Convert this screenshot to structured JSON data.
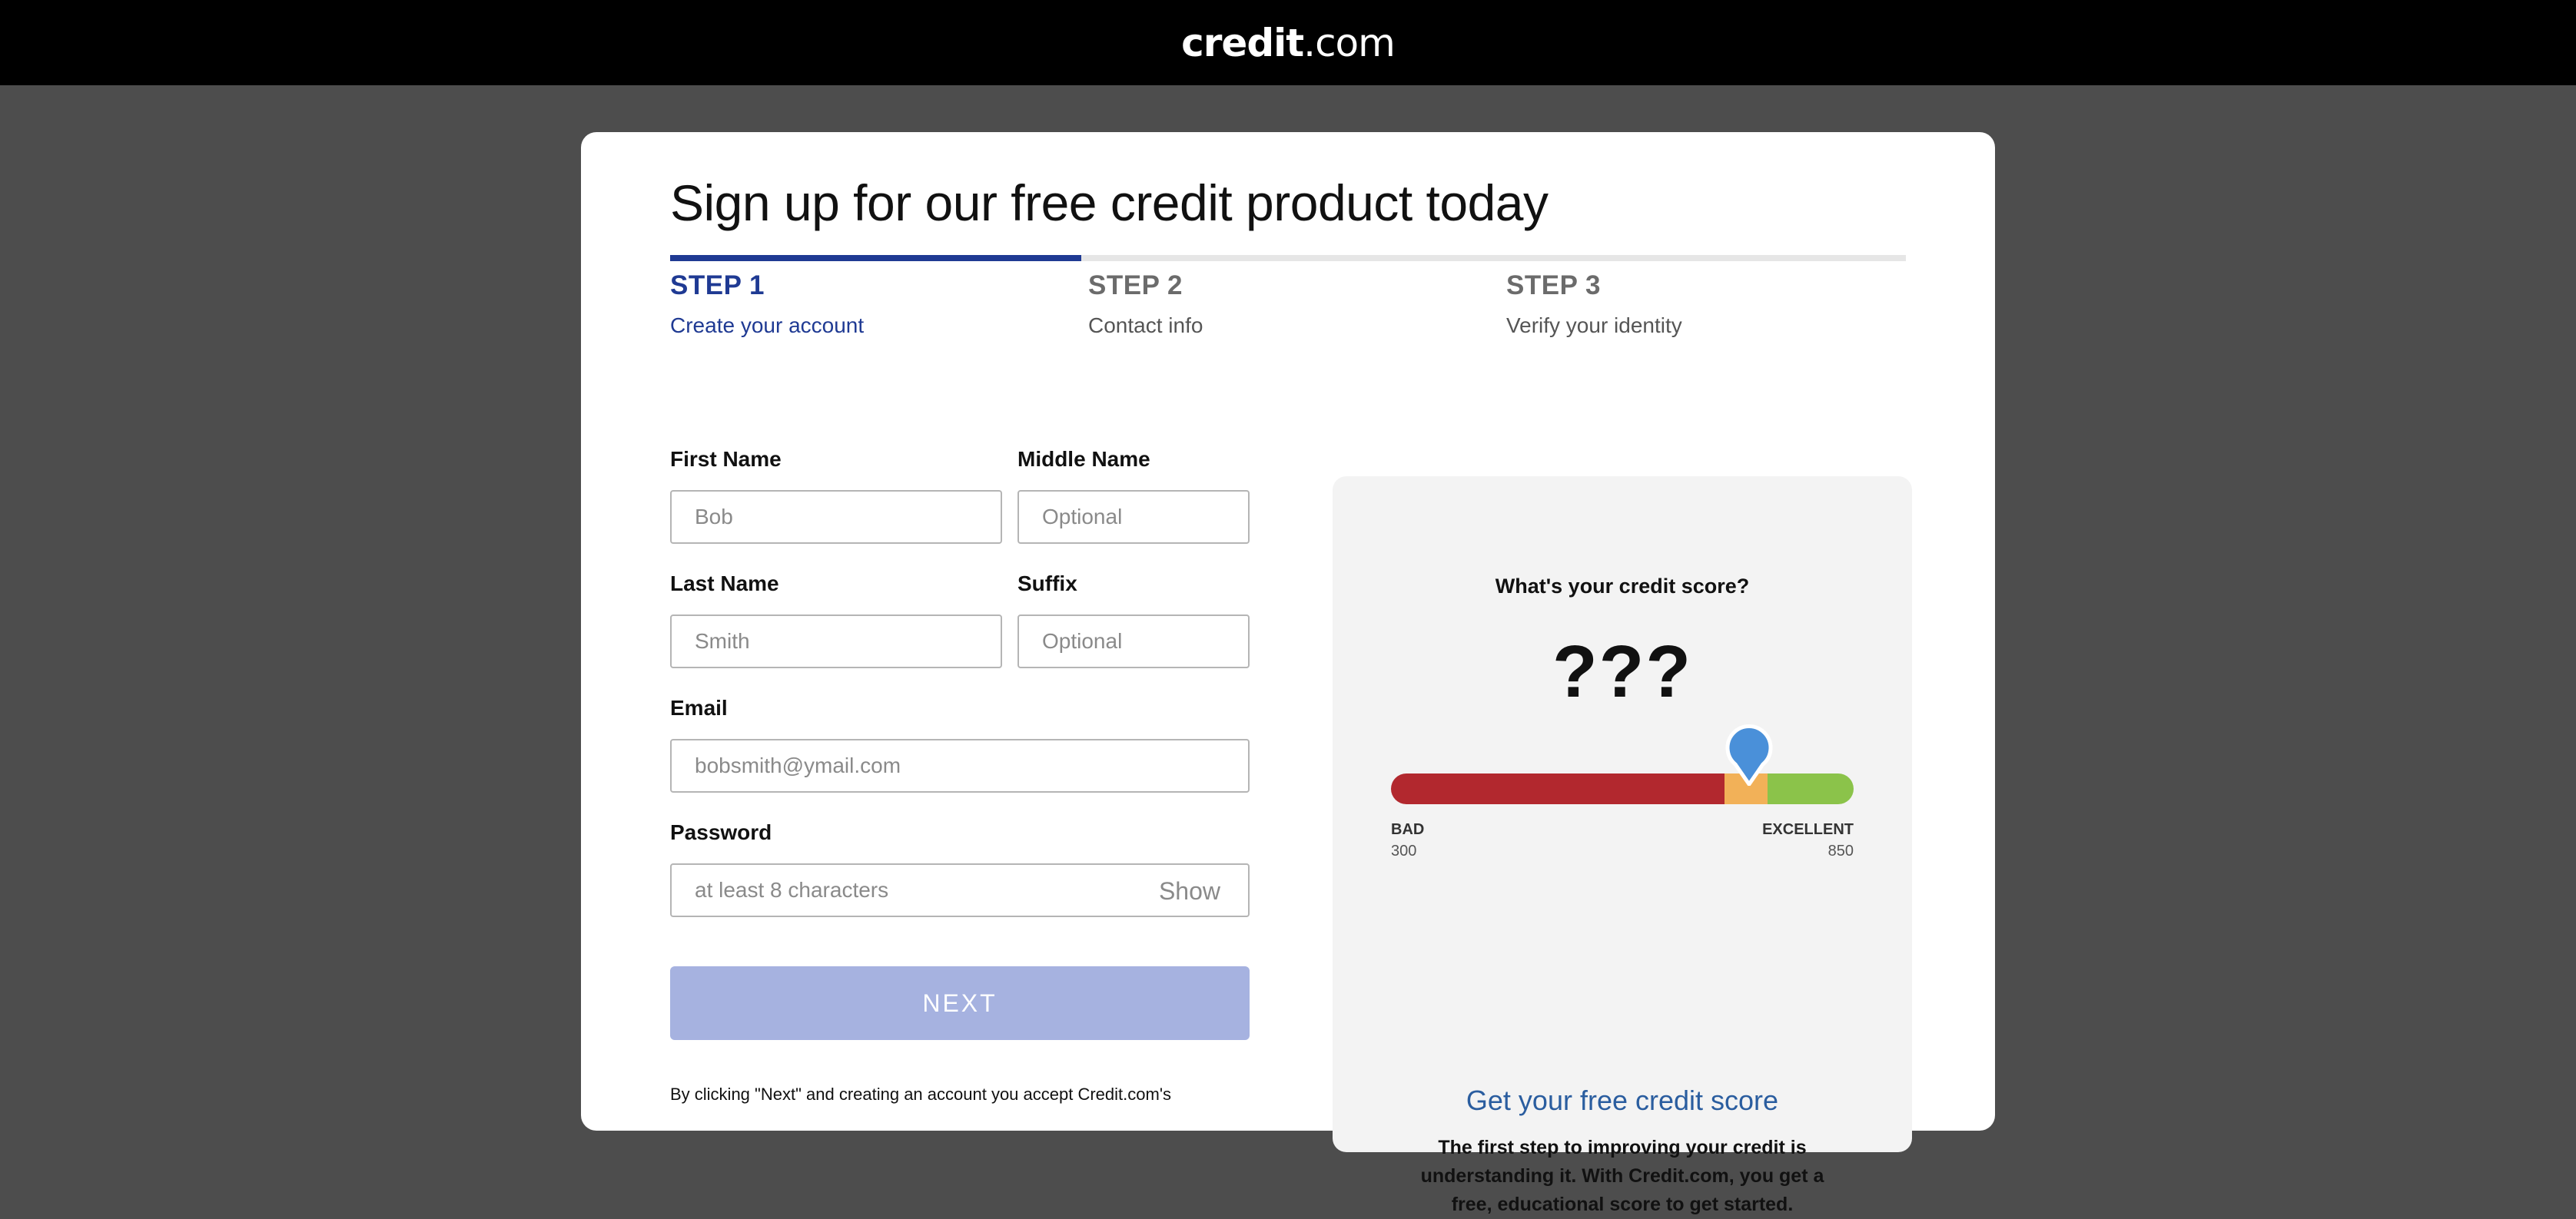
{
  "brand": {
    "logo_bold": "credit",
    "logo_rest": ".com"
  },
  "form": {
    "title": "Sign up for our free credit product today",
    "progress": 0.333,
    "steps": [
      {
        "num": "STEP 1",
        "sub": "Create your account",
        "active": true
      },
      {
        "num": "STEP 2",
        "sub": "Contact info",
        "active": false
      },
      {
        "num": "STEP 3",
        "sub": "Verify your identity",
        "active": false
      }
    ],
    "first_name": {
      "label": "First Name",
      "placeholder": "Bob"
    },
    "middle_name": {
      "label": "Middle Name",
      "placeholder": "Optional"
    },
    "last_name": {
      "label": "Last Name",
      "placeholder": "Smith"
    },
    "suffix": {
      "label": "Suffix",
      "placeholder": "Optional"
    },
    "email": {
      "label": "Email",
      "placeholder": "bobsmith@ymail.com"
    },
    "password": {
      "label": "Password",
      "placeholder": "at least 8 characters",
      "show_label": "Show"
    },
    "next_label": "NEXT",
    "terms": "By clicking \"Next\" and creating an account you accept Credit.com's"
  },
  "score_panel": {
    "question": "What's your credit score?",
    "score": "???",
    "scale": {
      "low_label": "BAD",
      "low_value": "300",
      "high_label": "EXCELLENT",
      "high_value": "850"
    },
    "cta": "Get your free credit score",
    "body": "The first step to improving your credit is understanding it. With Credit.com, you get a free, educational score to get started.",
    "colors": {
      "bad": "#b2282e",
      "fair": "#f2b158",
      "good": "#8bc34a",
      "pin": "#4a90d9"
    }
  }
}
